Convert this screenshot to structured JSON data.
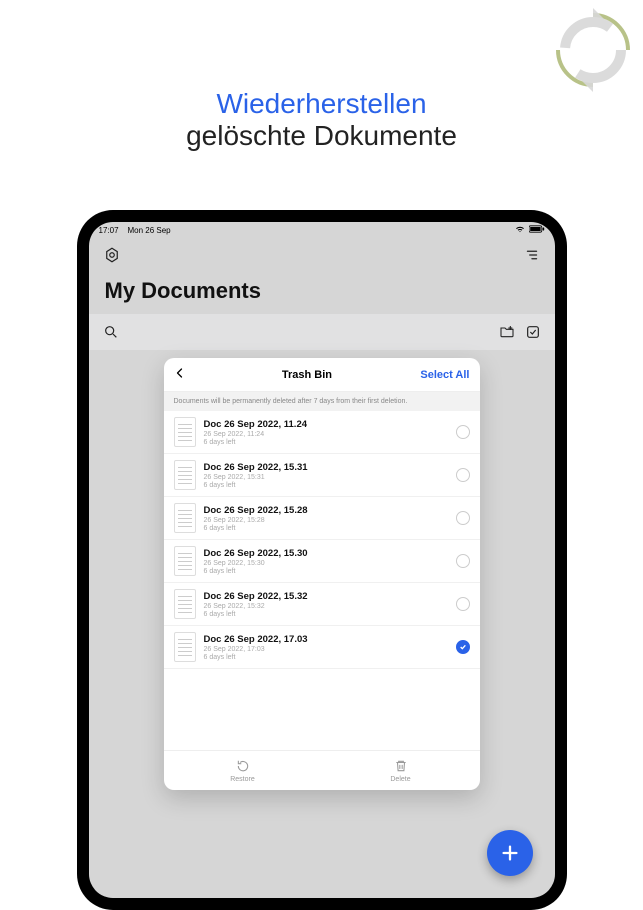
{
  "headline": {
    "line1": "Wiederherstellen",
    "line2": "gelöschte Dokumente"
  },
  "statusbar": {
    "time": "17:07",
    "date": "Mon 26 Sep"
  },
  "page": {
    "title": "My Documents"
  },
  "modal": {
    "title": "Trash Bin",
    "select_all": "Select All",
    "notice": "Documents will be permanently deleted after 7 days from their first deletion.",
    "restore_label": "Restore",
    "delete_label": "Delete"
  },
  "docs": [
    {
      "name": "Doc 26 Sep 2022, 11.24",
      "date": "26 Sep 2022, 11:24",
      "days": "6 days left",
      "selected": false
    },
    {
      "name": "Doc 26 Sep 2022, 15.31",
      "date": "26 Sep 2022, 15:31",
      "days": "6 days left",
      "selected": false
    },
    {
      "name": "Doc 26 Sep 2022, 15.28",
      "date": "26 Sep 2022, 15:28",
      "days": "6 days left",
      "selected": false
    },
    {
      "name": "Doc 26 Sep 2022, 15.30",
      "date": "26 Sep 2022, 15:30",
      "days": "6 days left",
      "selected": false
    },
    {
      "name": "Doc 26 Sep 2022, 15.32",
      "date": "26 Sep 2022, 15:32",
      "days": "6 days left",
      "selected": false
    },
    {
      "name": "Doc 26 Sep 2022, 17.03",
      "date": "26 Sep 2022, 17:03",
      "days": "6 days left",
      "selected": true
    }
  ],
  "colors": {
    "accent": "#2a62e8"
  }
}
